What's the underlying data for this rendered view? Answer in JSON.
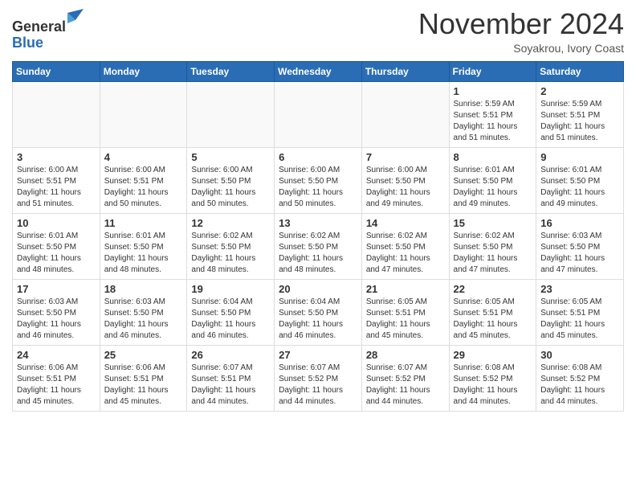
{
  "header": {
    "logo_line1": "General",
    "logo_line2": "Blue",
    "month": "November 2024",
    "location": "Soyakrou, Ivory Coast"
  },
  "weekdays": [
    "Sunday",
    "Monday",
    "Tuesday",
    "Wednesday",
    "Thursday",
    "Friday",
    "Saturday"
  ],
  "weeks": [
    [
      {
        "day": "",
        "info": ""
      },
      {
        "day": "",
        "info": ""
      },
      {
        "day": "",
        "info": ""
      },
      {
        "day": "",
        "info": ""
      },
      {
        "day": "",
        "info": ""
      },
      {
        "day": "1",
        "info": "Sunrise: 5:59 AM\nSunset: 5:51 PM\nDaylight: 11 hours\nand 51 minutes."
      },
      {
        "day": "2",
        "info": "Sunrise: 5:59 AM\nSunset: 5:51 PM\nDaylight: 11 hours\nand 51 minutes."
      }
    ],
    [
      {
        "day": "3",
        "info": "Sunrise: 6:00 AM\nSunset: 5:51 PM\nDaylight: 11 hours\nand 51 minutes."
      },
      {
        "day": "4",
        "info": "Sunrise: 6:00 AM\nSunset: 5:51 PM\nDaylight: 11 hours\nand 50 minutes."
      },
      {
        "day": "5",
        "info": "Sunrise: 6:00 AM\nSunset: 5:50 PM\nDaylight: 11 hours\nand 50 minutes."
      },
      {
        "day": "6",
        "info": "Sunrise: 6:00 AM\nSunset: 5:50 PM\nDaylight: 11 hours\nand 50 minutes."
      },
      {
        "day": "7",
        "info": "Sunrise: 6:00 AM\nSunset: 5:50 PM\nDaylight: 11 hours\nand 49 minutes."
      },
      {
        "day": "8",
        "info": "Sunrise: 6:01 AM\nSunset: 5:50 PM\nDaylight: 11 hours\nand 49 minutes."
      },
      {
        "day": "9",
        "info": "Sunrise: 6:01 AM\nSunset: 5:50 PM\nDaylight: 11 hours\nand 49 minutes."
      }
    ],
    [
      {
        "day": "10",
        "info": "Sunrise: 6:01 AM\nSunset: 5:50 PM\nDaylight: 11 hours\nand 48 minutes."
      },
      {
        "day": "11",
        "info": "Sunrise: 6:01 AM\nSunset: 5:50 PM\nDaylight: 11 hours\nand 48 minutes."
      },
      {
        "day": "12",
        "info": "Sunrise: 6:02 AM\nSunset: 5:50 PM\nDaylight: 11 hours\nand 48 minutes."
      },
      {
        "day": "13",
        "info": "Sunrise: 6:02 AM\nSunset: 5:50 PM\nDaylight: 11 hours\nand 48 minutes."
      },
      {
        "day": "14",
        "info": "Sunrise: 6:02 AM\nSunset: 5:50 PM\nDaylight: 11 hours\nand 47 minutes."
      },
      {
        "day": "15",
        "info": "Sunrise: 6:02 AM\nSunset: 5:50 PM\nDaylight: 11 hours\nand 47 minutes."
      },
      {
        "day": "16",
        "info": "Sunrise: 6:03 AM\nSunset: 5:50 PM\nDaylight: 11 hours\nand 47 minutes."
      }
    ],
    [
      {
        "day": "17",
        "info": "Sunrise: 6:03 AM\nSunset: 5:50 PM\nDaylight: 11 hours\nand 46 minutes."
      },
      {
        "day": "18",
        "info": "Sunrise: 6:03 AM\nSunset: 5:50 PM\nDaylight: 11 hours\nand 46 minutes."
      },
      {
        "day": "19",
        "info": "Sunrise: 6:04 AM\nSunset: 5:50 PM\nDaylight: 11 hours\nand 46 minutes."
      },
      {
        "day": "20",
        "info": "Sunrise: 6:04 AM\nSunset: 5:50 PM\nDaylight: 11 hours\nand 46 minutes."
      },
      {
        "day": "21",
        "info": "Sunrise: 6:05 AM\nSunset: 5:51 PM\nDaylight: 11 hours\nand 45 minutes."
      },
      {
        "day": "22",
        "info": "Sunrise: 6:05 AM\nSunset: 5:51 PM\nDaylight: 11 hours\nand 45 minutes."
      },
      {
        "day": "23",
        "info": "Sunrise: 6:05 AM\nSunset: 5:51 PM\nDaylight: 11 hours\nand 45 minutes."
      }
    ],
    [
      {
        "day": "24",
        "info": "Sunrise: 6:06 AM\nSunset: 5:51 PM\nDaylight: 11 hours\nand 45 minutes."
      },
      {
        "day": "25",
        "info": "Sunrise: 6:06 AM\nSunset: 5:51 PM\nDaylight: 11 hours\nand 45 minutes."
      },
      {
        "day": "26",
        "info": "Sunrise: 6:07 AM\nSunset: 5:51 PM\nDaylight: 11 hours\nand 44 minutes."
      },
      {
        "day": "27",
        "info": "Sunrise: 6:07 AM\nSunset: 5:52 PM\nDaylight: 11 hours\nand 44 minutes."
      },
      {
        "day": "28",
        "info": "Sunrise: 6:07 AM\nSunset: 5:52 PM\nDaylight: 11 hours\nand 44 minutes."
      },
      {
        "day": "29",
        "info": "Sunrise: 6:08 AM\nSunset: 5:52 PM\nDaylight: 11 hours\nand 44 minutes."
      },
      {
        "day": "30",
        "info": "Sunrise: 6:08 AM\nSunset: 5:52 PM\nDaylight: 11 hours\nand 44 minutes."
      }
    ]
  ]
}
